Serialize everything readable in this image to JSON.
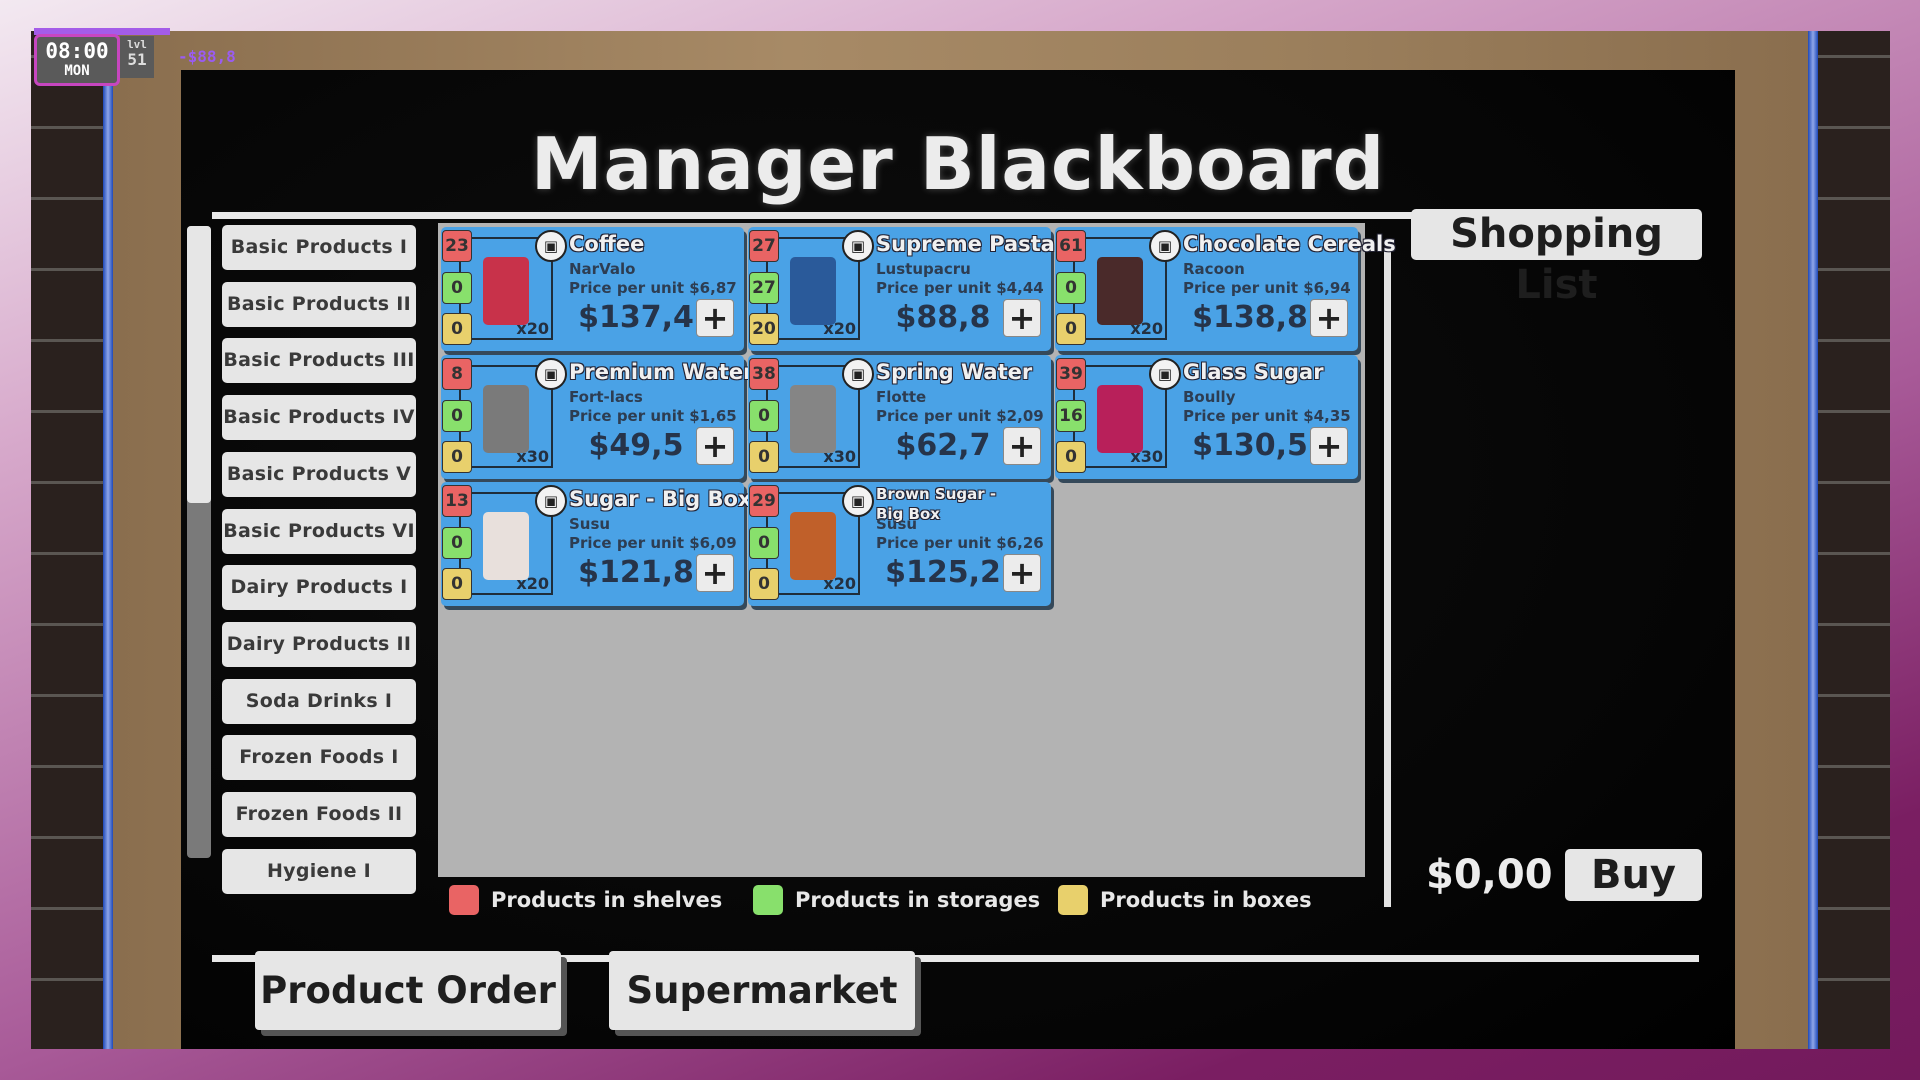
{
  "hud": {
    "time": "08:00",
    "day": "MON",
    "level_label": "lvl",
    "level": "51",
    "money_change": "-$88,8"
  },
  "board": {
    "title": "Manager Blackboard"
  },
  "categories": [
    {
      "label": "Basic Products I"
    },
    {
      "label": "Basic Products II"
    },
    {
      "label": "Basic Products III"
    },
    {
      "label": "Basic Products IV"
    },
    {
      "label": "Basic Products V"
    },
    {
      "label": "Basic Products VI"
    },
    {
      "label": "Dairy Products I"
    },
    {
      "label": "Dairy Products II"
    },
    {
      "label": "Soda Drinks I"
    },
    {
      "label": "Frozen Foods I"
    },
    {
      "label": "Frozen Foods II"
    },
    {
      "label": "Hygiene I"
    }
  ],
  "products": [
    {
      "name": "Coffee",
      "brand": "NarValo",
      "price_per_unit": "Price per unit $6,87",
      "total": "$137,4",
      "multiplier": "x20",
      "shelves": "23",
      "storages": "0",
      "boxes": "0",
      "image_color": "#c8324a"
    },
    {
      "name": "Supreme Pasta",
      "brand": "Lustupacru",
      "price_per_unit": "Price per unit $4,44",
      "total": "$88,8",
      "multiplier": "x20",
      "shelves": "27",
      "storages": "27",
      "boxes": "20",
      "image_color": "#2a5a9a"
    },
    {
      "name": "Chocolate Cereals",
      "brand": "Racoon",
      "price_per_unit": "Price per unit $6,94",
      "total": "$138,8",
      "multiplier": "x20",
      "shelves": "61",
      "storages": "0",
      "boxes": "0",
      "image_color": "#4a2a2a"
    },
    {
      "name": "Premium Water",
      "brand": "Fort-lacs",
      "price_per_unit": "Price per unit $1,65",
      "total": "$49,5",
      "multiplier": "x30",
      "shelves": "8",
      "storages": "0",
      "boxes": "0",
      "image_color": "#7a7a7a"
    },
    {
      "name": "Spring Water",
      "brand": "Flotte",
      "price_per_unit": "Price per unit $2,09",
      "total": "$62,7",
      "multiplier": "x30",
      "shelves": "38",
      "storages": "0",
      "boxes": "0",
      "image_color": "#858585"
    },
    {
      "name": "Glass Sugar",
      "brand": "Boully",
      "price_per_unit": "Price per unit $4,35",
      "total": "$130,5",
      "multiplier": "x30",
      "shelves": "39",
      "storages": "16",
      "boxes": "0",
      "image_color": "#b8205a"
    },
    {
      "name": "Sugar - Big Box",
      "brand": "Susu",
      "price_per_unit": "Price per unit $6,09",
      "total": "$121,8",
      "multiplier": "x20",
      "shelves": "13",
      "storages": "0",
      "boxes": "0",
      "image_color": "#e8e0dc"
    },
    {
      "name": "Brown Sugar - Big Box",
      "brand": "Susu",
      "price_per_unit": "Price per unit $6,26",
      "total": "$125,2",
      "multiplier": "x20",
      "shelves": "29",
      "storages": "0",
      "boxes": "0",
      "image_color": "#c0602a"
    }
  ],
  "legend": [
    {
      "label": "Products in shelves",
      "color": "#e96464"
    },
    {
      "label": "Products in storages",
      "color": "#88e06c"
    },
    {
      "label": "Products in boxes",
      "color": "#e8d06c"
    }
  ],
  "shopping_list": {
    "title": "Shopping List",
    "total": "$0,00",
    "buy_label": "Buy"
  },
  "nav": {
    "product_order": "Product Order",
    "supermarket": "Supermarket"
  },
  "icons": {
    "add": "+",
    "box": "▣"
  }
}
